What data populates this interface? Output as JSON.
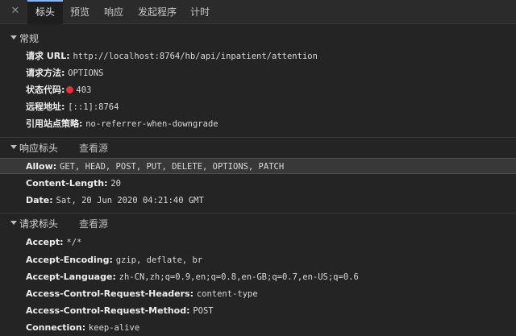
{
  "tabs": [
    {
      "label": "标头",
      "active": true
    },
    {
      "label": "预览",
      "active": false
    },
    {
      "label": "响应",
      "active": false
    },
    {
      "label": "发起程序",
      "active": false
    },
    {
      "label": "计时",
      "active": false
    }
  ],
  "general": {
    "title": "常规",
    "rows": [
      {
        "key": "请求 URL:",
        "value": "http://localhost:8764/hb/api/inpatient/attention"
      },
      {
        "key": "请求方法:",
        "value": "OPTIONS"
      },
      {
        "key": "状态代码:",
        "value": "403"
      },
      {
        "key": "远程地址:",
        "value": "[::1]:8764"
      },
      {
        "key": "引用站点策略:",
        "value": "no-referrer-when-downgrade"
      }
    ],
    "status_color": "#e8303a"
  },
  "response_headers": {
    "title": "响应标头",
    "view_source": "查看源",
    "rows": [
      {
        "key": "Allow:",
        "value": "GET, HEAD, POST, PUT, DELETE, OPTIONS, PATCH"
      },
      {
        "key": "Content-Length:",
        "value": "20"
      },
      {
        "key": "Date:",
        "value": "Sat, 20 Jun 2020 04:21:40 GMT"
      }
    ]
  },
  "request_headers": {
    "title": "请求标头",
    "view_source": "查看源",
    "rows": [
      {
        "key": "Accept:",
        "value": "*/*"
      },
      {
        "key": "Accept-Encoding:",
        "value": "gzip, deflate, br"
      },
      {
        "key": "Accept-Language:",
        "value": "zh-CN,zh;q=0.9,en;q=0.8,en-GB;q=0.7,en-US;q=0.6"
      },
      {
        "key": "Access-Control-Request-Headers:",
        "value": "content-type"
      },
      {
        "key": "Access-Control-Request-Method:",
        "value": "POST"
      },
      {
        "key": "Connection:",
        "value": "keep-alive"
      }
    ]
  },
  "icons": {
    "close": "close-icon",
    "collapse": "caret-down-icon"
  }
}
